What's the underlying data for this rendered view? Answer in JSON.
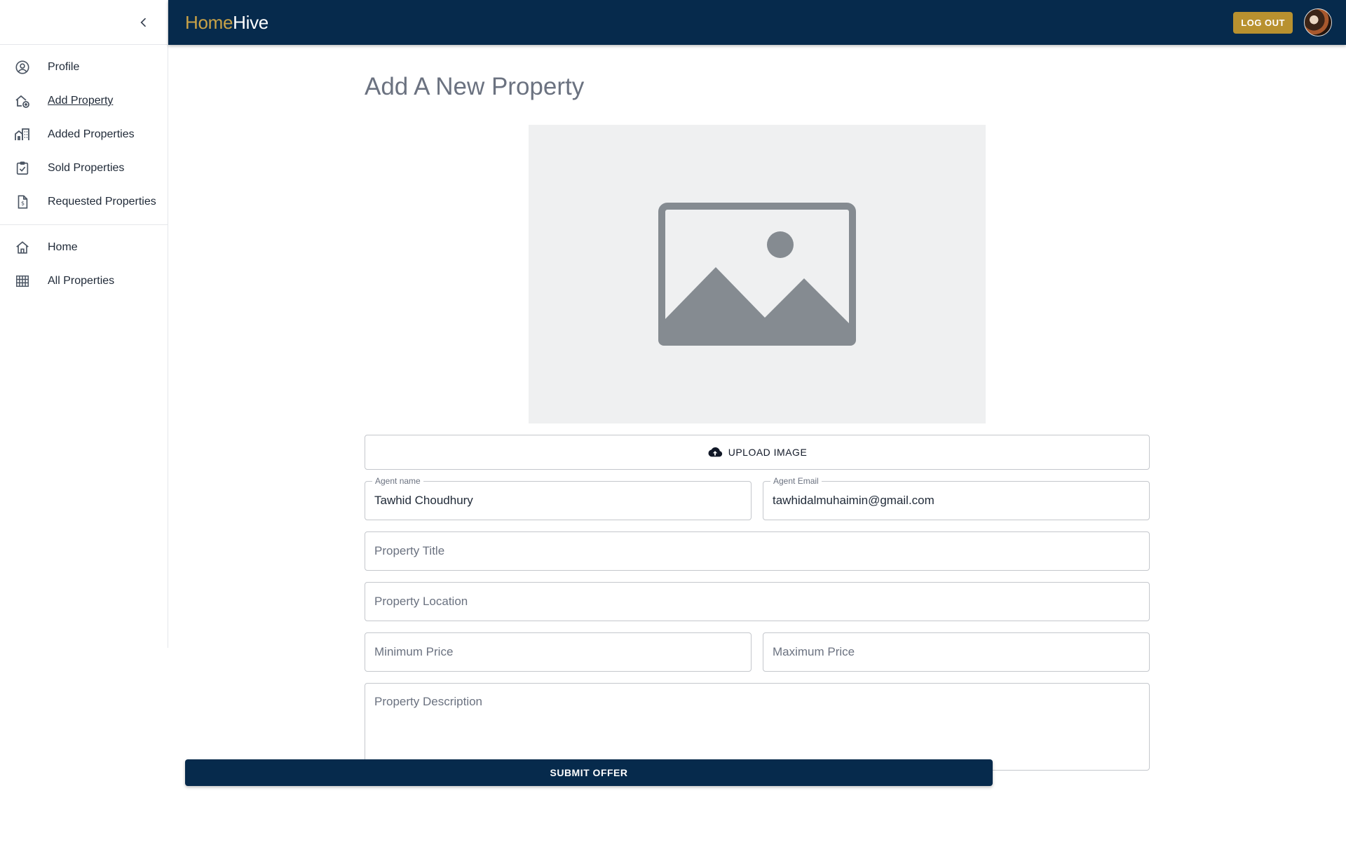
{
  "header": {
    "brand_home": "Home",
    "brand_hive": "Hive",
    "logout_label": "LOG OUT"
  },
  "sidebar": {
    "primary_items": [
      {
        "label": "Profile",
        "icon": "account-circle-icon"
      },
      {
        "label": "Add Property",
        "icon": "add-home-icon",
        "active": true
      },
      {
        "label": "Added Properties",
        "icon": "buildings-icon"
      },
      {
        "label": "Sold Properties",
        "icon": "clipboard-check-icon"
      },
      {
        "label": "Requested Properties",
        "icon": "document-dollar-icon"
      }
    ],
    "secondary_items": [
      {
        "label": "Home",
        "icon": "home-icon"
      },
      {
        "label": "All Properties",
        "icon": "grid-icon"
      }
    ]
  },
  "form": {
    "title": "Add A New Property",
    "upload_label": "UPLOAD IMAGE",
    "agent_name": {
      "label": "Agent name",
      "value": "Tawhid Choudhury"
    },
    "agent_email": {
      "label": "Agent Email",
      "value": "tawhidalmuhaimin@gmail.com"
    },
    "property_title": {
      "placeholder": "Property Title"
    },
    "property_location": {
      "placeholder": "Property Location"
    },
    "min_price": {
      "placeholder": "Minimum Price"
    },
    "max_price": {
      "placeholder": "Maximum Price"
    },
    "description": {
      "placeholder": "Property Description"
    },
    "submit_label": "SUBMIT OFFER"
  },
  "colors": {
    "navy": "#062a4c",
    "gold": "#b8912f",
    "brand_gold": "#c9a247"
  }
}
